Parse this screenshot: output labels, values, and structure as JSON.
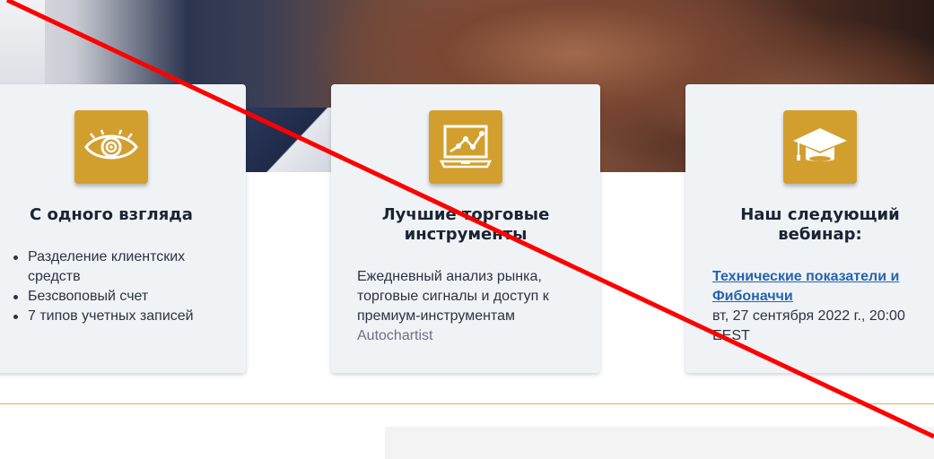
{
  "cards": [
    {
      "icon": "eye-icon",
      "title": "С одного взгляда",
      "items": [
        "Разделение клиентских средств",
        "Безсвоповый счет",
        "7 типов учетных записей"
      ]
    },
    {
      "icon": "chart-monitor-icon",
      "title": "Лучшие торговые инструменты",
      "text": "Ежедневный анализ рынка, торговые сигналы и доступ к премиум-инструментам",
      "text_muted": "Autochartist"
    },
    {
      "icon": "graduation-cap-icon",
      "title": "Наш следующий вебинар:",
      "link": "Технические показатели и Фибоначчи",
      "date": "вт, 27 сентября 2022 г., 20:00",
      "timezone": "EEST"
    }
  ],
  "colors": {
    "accent": "#d29f2f",
    "card_bg": "#f0f3f6",
    "link": "#2563b0",
    "strike_line": "#ff0000"
  }
}
